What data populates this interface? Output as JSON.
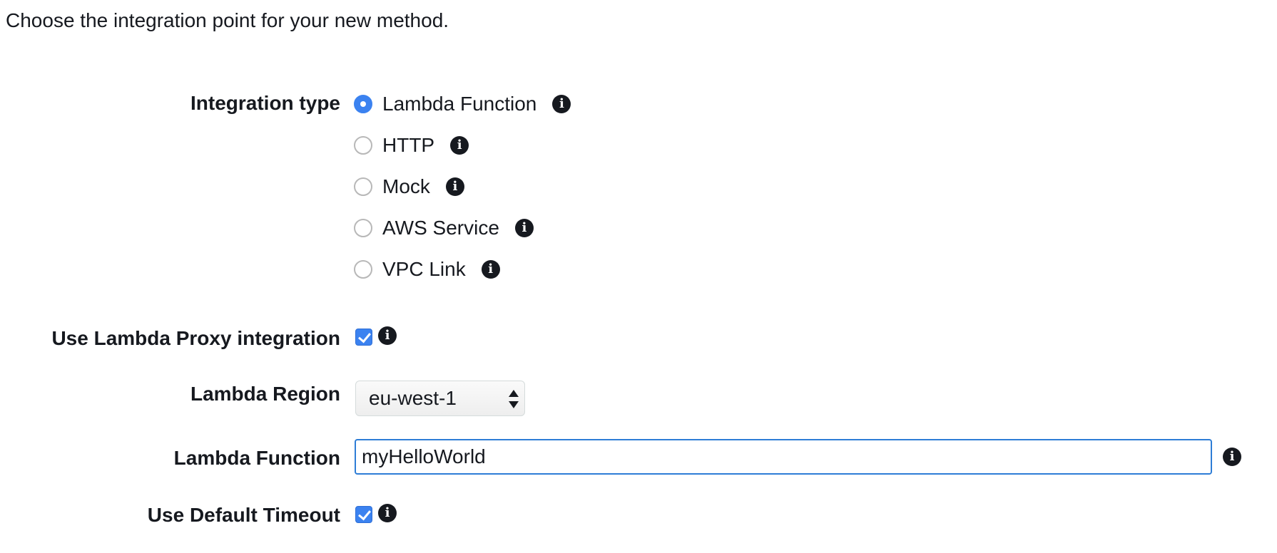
{
  "intro_text": "Choose the integration point for your new method.",
  "integration_type": {
    "label": "Integration type",
    "options": [
      {
        "label": "Lambda Function",
        "selected": true
      },
      {
        "label": "HTTP",
        "selected": false
      },
      {
        "label": "Mock",
        "selected": false
      },
      {
        "label": "AWS Service",
        "selected": false
      },
      {
        "label": "VPC Link",
        "selected": false
      }
    ]
  },
  "lambda_proxy": {
    "label": "Use Lambda Proxy integration",
    "checked": true
  },
  "lambda_region": {
    "label": "Lambda Region",
    "value": "eu-west-1"
  },
  "lambda_function": {
    "label": "Lambda Function",
    "value": "myHelloWorld"
  },
  "default_timeout": {
    "label": "Use Default Timeout",
    "checked": true
  },
  "icons": {
    "info": "info-icon",
    "info_glyph": "i"
  },
  "colors": {
    "accent": "#3b82f0",
    "input_focus_border": "#2e7dd6",
    "text": "#16191f"
  }
}
